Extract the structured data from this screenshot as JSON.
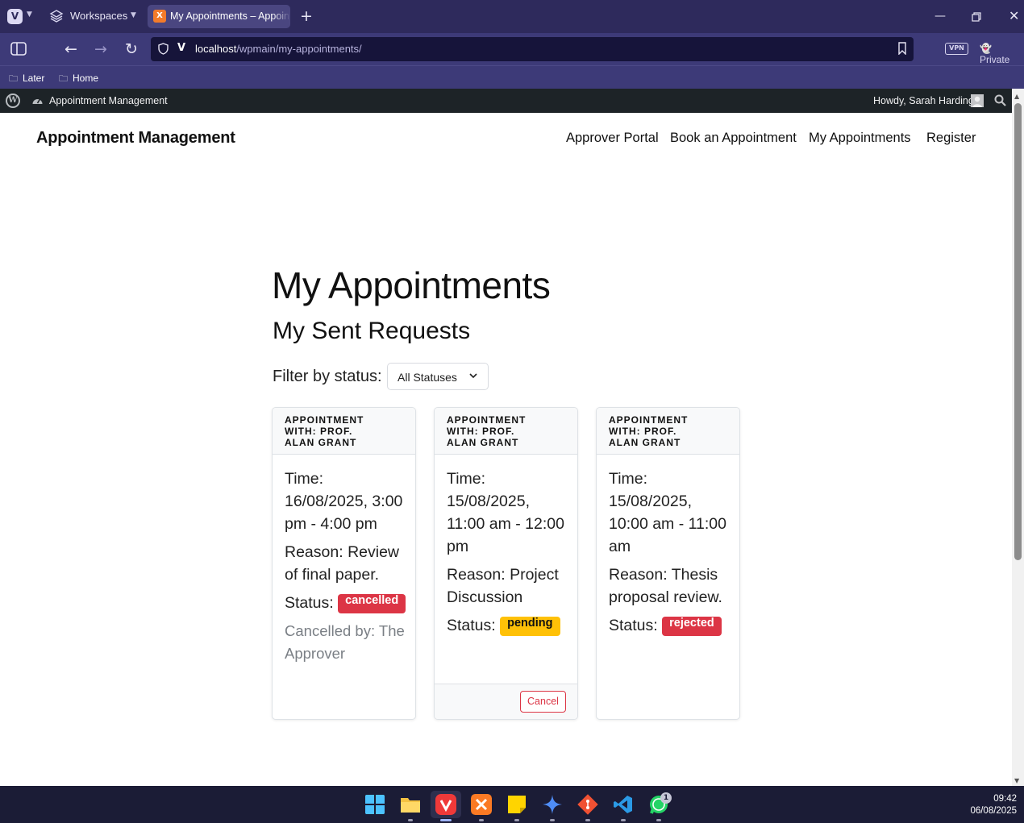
{
  "browser": {
    "workspaces_label": "Workspaces",
    "tab_title": "My Appointments – Appointment Management",
    "url_host": "localhost",
    "url_path": "/wpmain/my-appointments/",
    "vpn_label": "VPN",
    "private_label": "Private",
    "bookmarks": [
      "Later",
      "Home"
    ]
  },
  "wp_admin_bar": {
    "site_name": "Appointment Management",
    "howdy": "Howdy, Sarah Harding"
  },
  "site": {
    "title": "Appointment Management",
    "nav": [
      "Approver Portal",
      "Book an Appointment",
      "My Appointments",
      "Register"
    ]
  },
  "page": {
    "heading": "My Appointments",
    "subheading": "My Sent Requests",
    "filter_label": "Filter by status:",
    "filter_value": "All Statuses"
  },
  "cards": [
    {
      "header": "Appointment with: Prof. Alan Grant",
      "time_label": "Time:",
      "time_value": "16/08/2025, 3:00 pm - 4:00 pm",
      "reason_label": "Reason:",
      "reason_value": "Review of final paper.",
      "status_label": "Status:",
      "status": "cancelled",
      "note": "Cancelled by: The Approver"
    },
    {
      "header": "Appointment with: Prof. Alan Grant",
      "time_label": "Time:",
      "time_value": "15/08/2025, 11:00 am - 12:00 pm",
      "reason_label": "Reason:",
      "reason_value": "Project Discussion",
      "status_label": "Status:",
      "status": "pending",
      "action": "Cancel"
    },
    {
      "header": "Appointment with: Prof. Alan Grant",
      "time_label": "Time:",
      "time_value": "15/08/2025, 10:00 am - 11:00 am",
      "reason_label": "Reason:",
      "reason_value": "Thesis proposal review.",
      "status_label": "Status:",
      "status": "rejected"
    }
  ],
  "colors": {
    "danger": "#dc3545",
    "warning": "#ffc107",
    "browser_chrome": "#2e2a5c",
    "wp_admin_bar": "#1d2327"
  },
  "taskbar": {
    "apps": [
      "windows-start",
      "file-explorer",
      "vivaldi",
      "xampp",
      "sticky-notes",
      "gemini",
      "git",
      "vscode",
      "whatsapp"
    ],
    "whatsapp_badge": "1",
    "time": "09:42",
    "date": "06/08/2025"
  }
}
